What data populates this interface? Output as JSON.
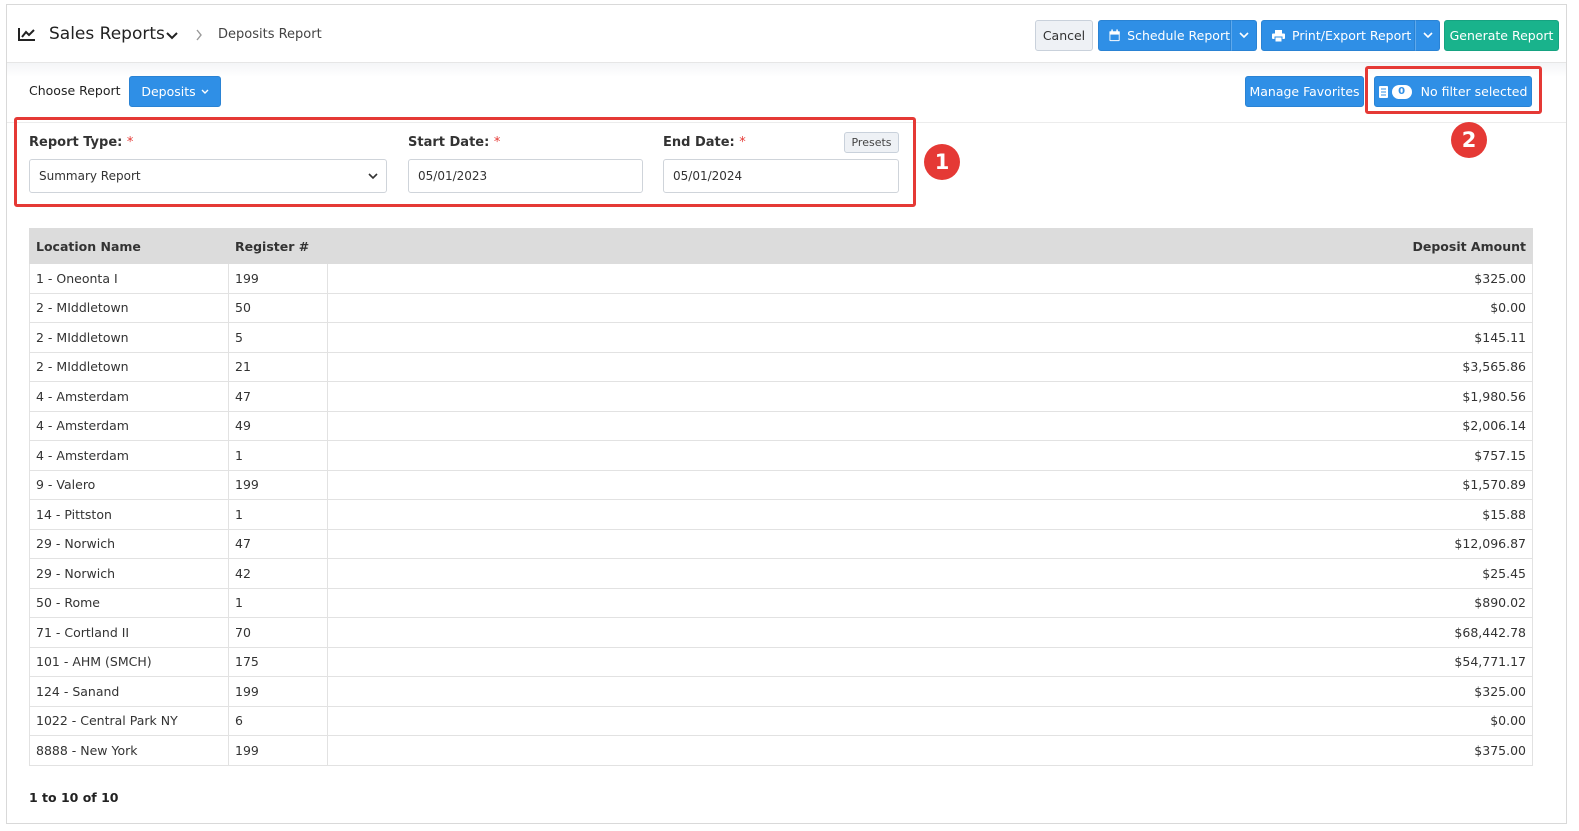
{
  "header": {
    "title": "Sales Reports",
    "breadcrumb_current": "Deposits Report",
    "cancel_label": "Cancel",
    "schedule_label": "Schedule Report",
    "print_label": "Print/Export Report",
    "generate_label": "Generate Report"
  },
  "toolbar": {
    "choose_label": "Choose Report",
    "report_dropdown": "Deposits",
    "favorites_label": "Manage Favorites",
    "filter_count": "0",
    "filter_label": "No filter selected"
  },
  "form": {
    "report_type_label": "Report Type:",
    "report_type_value": "Summary Report",
    "start_label": "Start Date:",
    "start_value": "05/01/2023",
    "end_label": "End Date:",
    "end_value": "05/01/2024",
    "presets_label": "Presets",
    "required_mark": "*"
  },
  "annotations": {
    "marker1": "1",
    "marker2": "2"
  },
  "colors": {
    "accent_blue": "#2f8fe6",
    "accent_green": "#19b38c",
    "highlight_red": "#e53935"
  },
  "table": {
    "headers": [
      "Location Name",
      "Register #",
      "Deposit Amount"
    ],
    "rows": [
      [
        "1 - Oneonta I",
        "199",
        "$325.00"
      ],
      [
        "2 - MIddletown",
        "50",
        "$0.00"
      ],
      [
        "2 - MIddletown",
        "5",
        "$145.11"
      ],
      [
        "2 - MIddletown",
        "21",
        "$3,565.86"
      ],
      [
        "4 - Amsterdam",
        "47",
        "$1,980.56"
      ],
      [
        "4 - Amsterdam",
        "49",
        "$2,006.14"
      ],
      [
        "4 - Amsterdam",
        "1",
        "$757.15"
      ],
      [
        "9 - Valero",
        "199",
        "$1,570.89"
      ],
      [
        "14 - Pittston",
        "1",
        "$15.88"
      ],
      [
        "29 - Norwich",
        "47",
        "$12,096.87"
      ],
      [
        "29 - Norwich",
        "42",
        "$25.45"
      ],
      [
        "50 - Rome",
        "1",
        "$890.02"
      ],
      [
        "71 - Cortland II",
        "70",
        "$68,442.78"
      ],
      [
        "101 - AHM (SMCH)",
        "175",
        "$54,771.17"
      ],
      [
        "124 - Sanand",
        "199",
        "$325.00"
      ],
      [
        "1022 - Central Park NY",
        "6",
        "$0.00"
      ],
      [
        "8888 - New York",
        "199",
        "$375.00"
      ]
    ],
    "pagination": "1 to 10 of 10"
  }
}
